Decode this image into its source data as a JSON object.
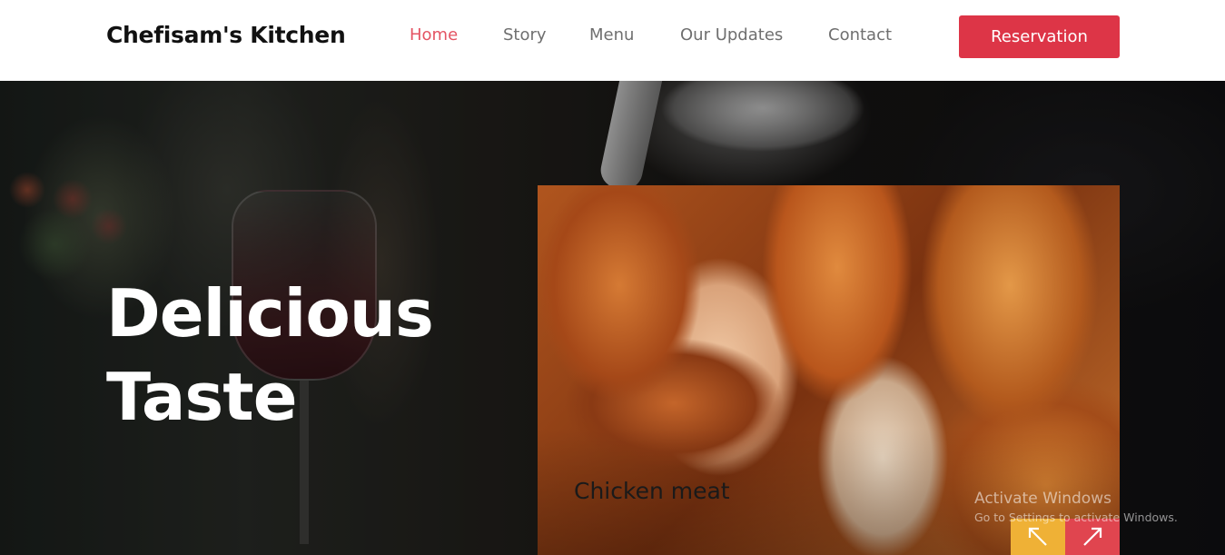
{
  "header": {
    "brand": "Chefisam's Kitchen",
    "nav": [
      {
        "label": "Home",
        "active": true
      },
      {
        "label": "Story",
        "active": false
      },
      {
        "label": "Menu",
        "active": false
      },
      {
        "label": "Our Updates",
        "active": false
      },
      {
        "label": "Contact",
        "active": false
      }
    ],
    "reservation_label": "Reservation"
  },
  "hero": {
    "title_line1": "Delicious",
    "title_line2": "Taste",
    "card_caption": "Chicken meat",
    "prev_icon": "arrow-up-left-icon",
    "next_icon": "arrow-up-right-icon"
  },
  "watermark": {
    "title": "Activate Windows",
    "subtitle": "Go to Settings to activate Windows."
  },
  "colors": {
    "accent": "#dd3547",
    "nav_active": "#e45463",
    "prev_button": "#efb136",
    "next_button": "#e0454f"
  }
}
